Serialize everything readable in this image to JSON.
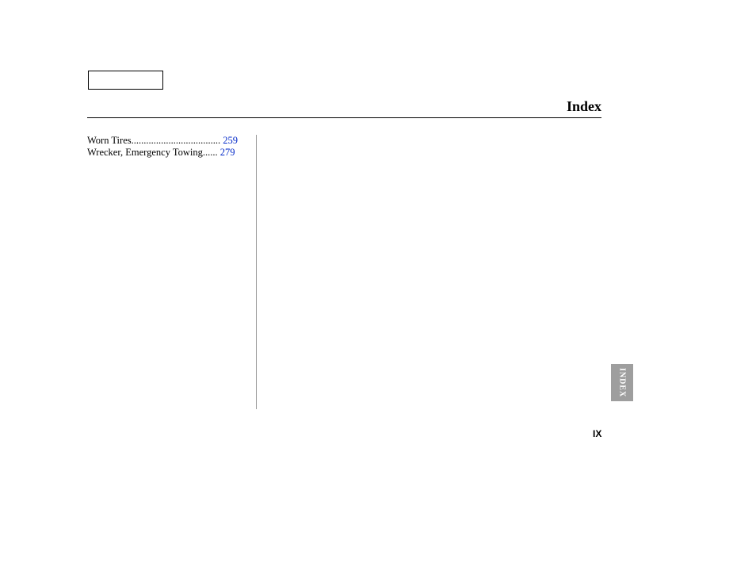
{
  "header": {
    "title": "Index"
  },
  "index": {
    "entries": [
      {
        "term": "Worn Tires",
        "leader": "....................................",
        "page": "259"
      },
      {
        "term": "Wrecker, Emergency Towing",
        "leader": "......",
        "page": "279"
      }
    ]
  },
  "side_tab": {
    "label": "INDEX"
  },
  "footer": {
    "roman": "IX"
  }
}
